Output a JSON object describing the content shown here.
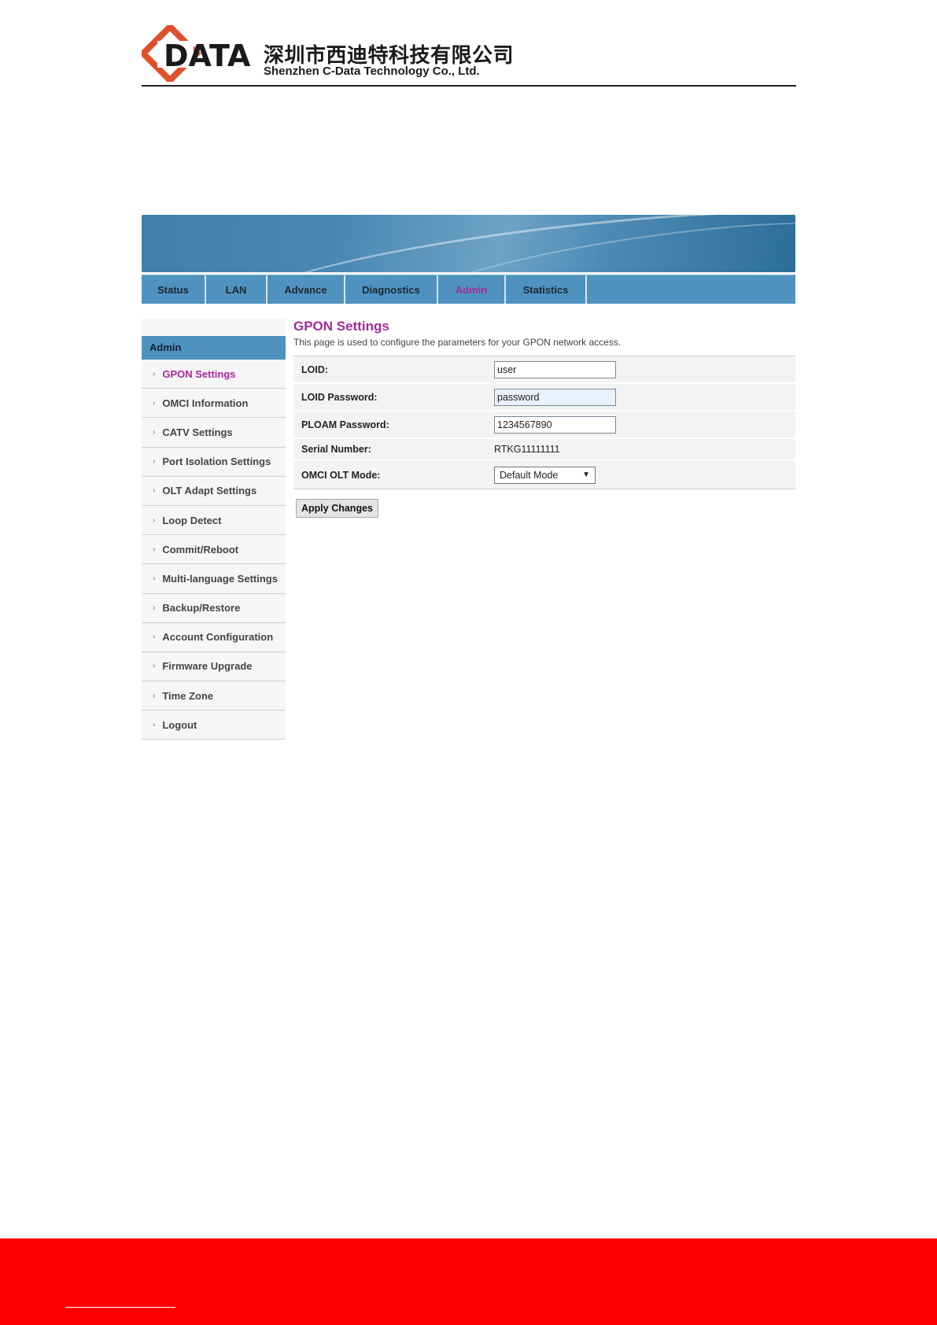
{
  "company": {
    "logo_text": "DATA",
    "name_cn": "深圳市西迪特科技有限公司",
    "name_en": "Shenzhen C-Data Technology Co., Ltd."
  },
  "colors": {
    "accent": "#a5299a",
    "nav_blue": "#4f92bf",
    "logo_red": "#e0502a",
    "footer_red": "#ff0000"
  },
  "topnav": {
    "tabs": [
      {
        "label": "Status"
      },
      {
        "label": "LAN"
      },
      {
        "label": "Advance"
      },
      {
        "label": "Diagnostics"
      },
      {
        "label": "Admin",
        "active": true
      },
      {
        "label": "Statistics"
      }
    ]
  },
  "sidebar": {
    "heading": "Admin",
    "items": [
      {
        "label": "GPON Settings",
        "active": true
      },
      {
        "label": "OMCI Information"
      },
      {
        "label": "CATV Settings"
      },
      {
        "label": "Port Isolation Settings"
      },
      {
        "label": "OLT Adapt Settings"
      },
      {
        "label": "Loop Detect"
      },
      {
        "label": "Commit/Reboot"
      },
      {
        "label": "Multi-language Settings"
      },
      {
        "label": "Backup/Restore"
      },
      {
        "label": "Account Configuration"
      },
      {
        "label": "Firmware Upgrade"
      },
      {
        "label": "Time Zone"
      },
      {
        "label": "Logout"
      }
    ]
  },
  "main": {
    "title": "GPON Settings",
    "description": "This page is used to configure the parameters for your GPON network access.",
    "fields": {
      "loid": {
        "label": "LOID:",
        "value": "user"
      },
      "loid_password": {
        "label": "LOID Password:",
        "value": "password"
      },
      "ploam_password": {
        "label": "PLOAM Password:",
        "value": "1234567890"
      },
      "serial_number": {
        "label": "Serial Number:",
        "value": "RTKG11111111"
      },
      "omci_olt_mode": {
        "label": "OMCI OLT Mode:",
        "value": "Default Mode"
      }
    },
    "apply_label": "Apply Changes"
  }
}
